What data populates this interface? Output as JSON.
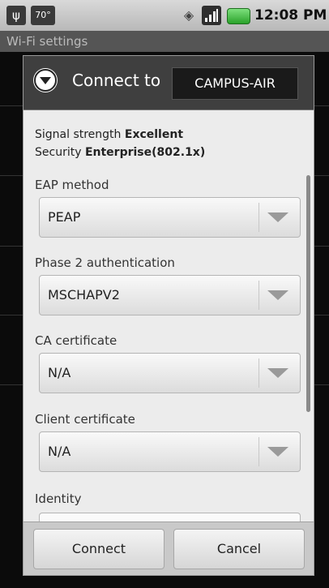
{
  "status_bar": {
    "temperature": "70°",
    "time": "12:08 PM",
    "icons": [
      "usb-icon",
      "temperature-icon",
      "vibrate-icon",
      "signal-icon",
      "battery-icon"
    ],
    "battery_color": "#3cbb3c"
  },
  "background": {
    "title": "Wi-Fi settings"
  },
  "dialog": {
    "title": "Connect to",
    "ssid": "CAMPUS-AIR",
    "signal_label": "Signal strength",
    "signal_value": "Excellent",
    "security_label": "Security",
    "security_value": "Enterprise(802.1x)",
    "fields": [
      {
        "label": "EAP method",
        "value": "PEAP"
      },
      {
        "label": "Phase 2 authentication",
        "value": "MSCHAPV2"
      },
      {
        "label": "CA certificate",
        "value": "N/A"
      },
      {
        "label": "Client certificate",
        "value": "N/A"
      }
    ],
    "identity_label": "Identity",
    "identity_value": "",
    "buttons": {
      "connect": "Connect",
      "cancel": "Cancel"
    }
  }
}
